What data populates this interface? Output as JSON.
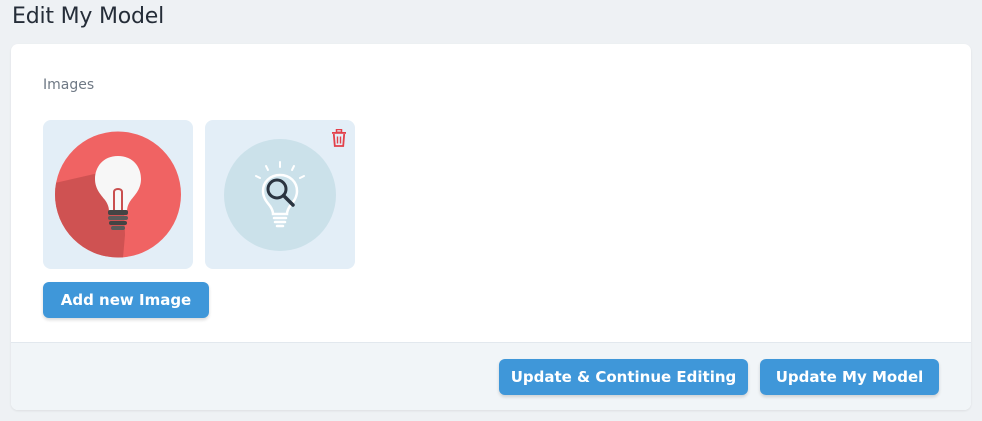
{
  "header": {
    "title": "Edit My Model"
  },
  "form": {
    "images_label": "Images",
    "images": [
      {
        "icon": "lightbulb-image-icon"
      },
      {
        "icon": "lightbulb-search-image-icon"
      }
    ],
    "add_image_label": "Add new Image"
  },
  "footer": {
    "update_continue_label": "Update & Continue Editing",
    "update_label": "Update My Model"
  },
  "colors": {
    "primary": "#3f97d9",
    "background": "#eef1f4",
    "card": "#ffffff",
    "thumb_bg": "#e3eef7",
    "delete": "#e3404a"
  }
}
